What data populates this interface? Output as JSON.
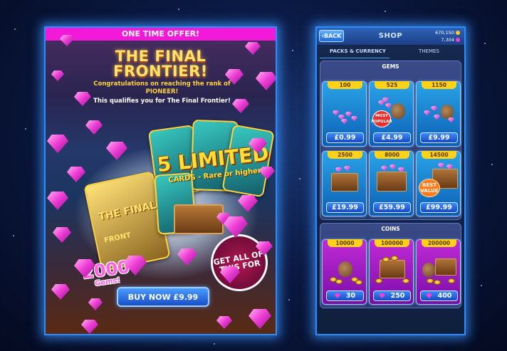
{
  "offer": {
    "banner": "ONE TIME OFFER!",
    "title_line1": "THE FINAL",
    "title_line2": "FRONTIER!",
    "congrats_line1": "Congratulations on reaching the rank of",
    "congrats_line2": "PIONEER!",
    "qualifies": "This qualifies you for The Final Frontier!",
    "limited_title": "5 LIMITED",
    "limited_sub": "CARDS - Rare or higher!",
    "card_title": "THE FINAL",
    "card_sub": "FRONT",
    "gems_amount": "2000",
    "gems_label": "Gems!",
    "get_all": "GET ALL OF THIS FOR",
    "buy_button": "BUY NOW £9.99"
  },
  "shop": {
    "back": "BACK",
    "title": "SHOP",
    "coins_balance": "670,150",
    "gems_balance": "7,304",
    "tabs": [
      "PACKS & CURRENCY",
      "THEMES"
    ],
    "active_tab": "PACKS & CURRENCY",
    "gems_section": {
      "title": "GEMS",
      "items": [
        {
          "amount": "100",
          "price": "£0.99"
        },
        {
          "amount": "525",
          "price": "£4.99",
          "badge": "MOST POPULAR"
        },
        {
          "amount": "1150",
          "price": "£9.99"
        },
        {
          "amount": "2500",
          "price": "£19.99"
        },
        {
          "amount": "8000",
          "price": "£59.99"
        },
        {
          "amount": "14500",
          "price": "£99.99",
          "badge": "BEST VALUE"
        }
      ]
    },
    "coins_section": {
      "title": "COINS",
      "items": [
        {
          "amount": "10000",
          "price": "30"
        },
        {
          "amount": "100000",
          "price": "250"
        },
        {
          "amount": "200000",
          "price": "400"
        }
      ]
    },
    "badges": {
      "most_line1": "MOST",
      "most_line2": "POPULAR",
      "best_line1": "BEST",
      "best_line2": "VALUE"
    }
  },
  "colors": {
    "banner": "#f21ad8",
    "gem": "#f040d6",
    "coin": "#ffd21a",
    "frame_glow": "#2a8cff"
  }
}
